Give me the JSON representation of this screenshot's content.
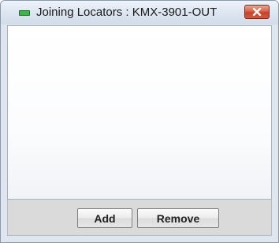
{
  "window": {
    "title": "Joining Locators : KMX-3901-OUT",
    "status_color": "#3fb64a",
    "close_icon": "close-x-icon"
  },
  "list": {
    "items": []
  },
  "footer": {
    "add_label": "Add",
    "remove_label": "Remove"
  }
}
